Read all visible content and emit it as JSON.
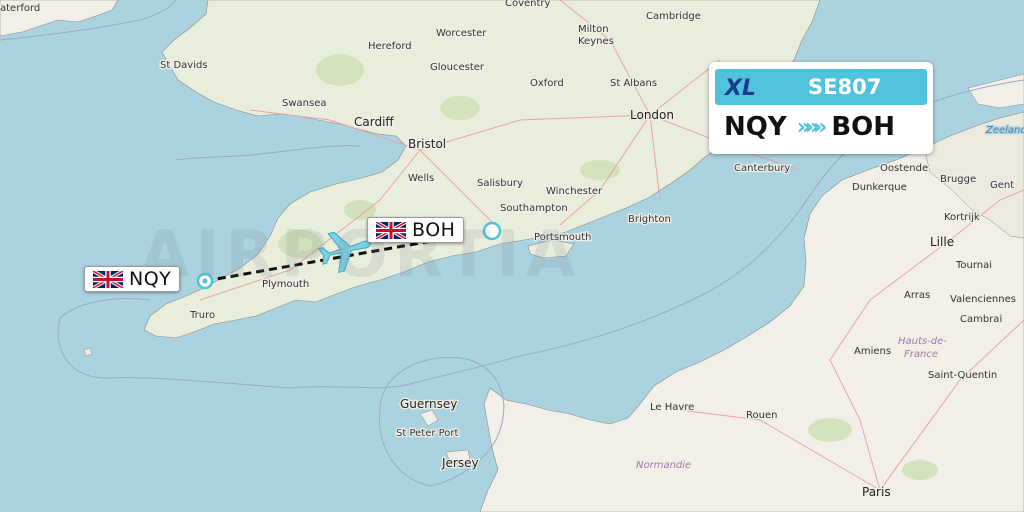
{
  "flight": {
    "number": "SE807",
    "airline_logo": "XL",
    "origin": "NQY",
    "destination": "BOH",
    "route_arrows": "»»»"
  },
  "colors": {
    "accent": "#4fc3dc",
    "sea": "#aad3df",
    "land": "#f2efe9",
    "route_line": "#111111"
  },
  "watermark": "AIRPORTIA",
  "places": [
    {
      "id": "waterford",
      "label": "aterford"
    },
    {
      "id": "st-davids",
      "label": "St Davids"
    },
    {
      "id": "hereford",
      "label": "Hereford"
    },
    {
      "id": "worcester",
      "label": "Worcester"
    },
    {
      "id": "coventry",
      "label": "Coventry"
    },
    {
      "id": "milton-keynes",
      "label": "Milton\nKeynes"
    },
    {
      "id": "cambridge",
      "label": "Cambridge"
    },
    {
      "id": "gloucester",
      "label": "Gloucester"
    },
    {
      "id": "oxford",
      "label": "Oxford"
    },
    {
      "id": "st-albans",
      "label": "St Albans"
    },
    {
      "id": "swansea",
      "label": "Swansea"
    },
    {
      "id": "cardiff",
      "label": "Cardiff"
    },
    {
      "id": "london",
      "label": "London"
    },
    {
      "id": "bristol",
      "label": "Bristol"
    },
    {
      "id": "wells",
      "label": "Wells"
    },
    {
      "id": "salisbury",
      "label": "Salisbury"
    },
    {
      "id": "winchester",
      "label": "Winchester"
    },
    {
      "id": "canterbury",
      "label": "Canterbury"
    },
    {
      "id": "southampton",
      "label": "Southampton"
    },
    {
      "id": "brighton",
      "label": "Brighton"
    },
    {
      "id": "portsmouth",
      "label": "Portsmouth"
    },
    {
      "id": "plymouth",
      "label": "Plymouth"
    },
    {
      "id": "truro",
      "label": "Truro"
    },
    {
      "id": "guernsey",
      "label": "Guernsey"
    },
    {
      "id": "st-peter-port",
      "label": "St Peter Port"
    },
    {
      "id": "jersey",
      "label": "Jersey"
    },
    {
      "id": "normandie",
      "label": "Normandie"
    },
    {
      "id": "le-havre",
      "label": "Le Havre"
    },
    {
      "id": "rouen",
      "label": "Rouen"
    },
    {
      "id": "paris",
      "label": "Paris"
    },
    {
      "id": "amiens",
      "label": "Amiens"
    },
    {
      "id": "hauts-de-france",
      "label": "Hauts-de-\nFrance"
    },
    {
      "id": "saint-quentin",
      "label": "Saint-Quentin"
    },
    {
      "id": "arras",
      "label": "Arras"
    },
    {
      "id": "valenciennes",
      "label": "Valenciennes"
    },
    {
      "id": "cambrai",
      "label": "Cambrai"
    },
    {
      "id": "lille",
      "label": "Lille"
    },
    {
      "id": "tournai",
      "label": "Tournai"
    },
    {
      "id": "kortrijk",
      "label": "Kortrijk"
    },
    {
      "id": "dunkerque",
      "label": "Dunkerque"
    },
    {
      "id": "oostende",
      "label": "Oostende"
    },
    {
      "id": "brugge",
      "label": "Brugge"
    },
    {
      "id": "gent",
      "label": "Gent"
    },
    {
      "id": "zeeland",
      "label": "Zeeland"
    }
  ]
}
